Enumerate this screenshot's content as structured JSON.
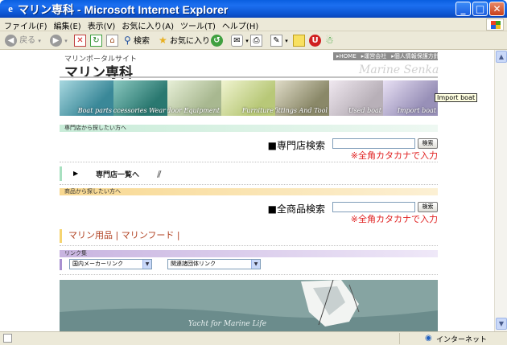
{
  "window": {
    "title": "マリン専科 - Microsoft Internet Explorer",
    "buttons": {
      "minimize": "_",
      "maximize": "□",
      "close": "✕"
    }
  },
  "menubar": {
    "items": [
      "ファイル(F)",
      "編集(E)",
      "表示(V)",
      "お気に入り(A)",
      "ツール(T)",
      "ヘルプ(H)"
    ]
  },
  "toolbar": {
    "back_label": "戻る",
    "search_label": "検索",
    "favorites_label": "お気に入り"
  },
  "page": {
    "portal_name": "マリンポータルサイト",
    "site_title": "マリン専科",
    "site_title_en": "Marine Senka",
    "topnav": [
      "▸HOME",
      "▸運営会社",
      "▸個人情報保護方針"
    ],
    "banners": [
      {
        "label": "Boat parts",
        "color_a": "#3a8898",
        "color_b": "#a8d8e0"
      },
      {
        "label": "Accessories Wear",
        "color_a": "#2a7870",
        "color_b": "#8ac8c0"
      },
      {
        "label": "The indoor Equipment",
        "color_a": "#a8b890",
        "color_b": "#e8f0d8"
      },
      {
        "label": "Furniture",
        "color_a": "#b8c878",
        "color_b": "#f0f4d0"
      },
      {
        "label": "Metal fittings And Tool",
        "color_a": "#8a8868",
        "color_b": "#e0dcc8"
      },
      {
        "label": "Used boat",
        "color_a": "#b8b0b8",
        "color_b": "#f0e8f0"
      },
      {
        "label": "Import boat",
        "color_a": "#9890b8",
        "color_b": "#e8e0f4"
      }
    ],
    "tooltip": "Import boat",
    "shop_section_title": "専門店から探したい方へ",
    "shop_search_label": "■専門店検索",
    "search_button": "検索",
    "katakana_note": "※全角カタカナで入力",
    "shop_list_label": "専門店一覧へ",
    "product_section_title": "商品から探したい方へ",
    "product_search_label": "■全商品検索",
    "category_links": "マリン用品 | マリンフード |",
    "links_section_title": "リンク集",
    "select1": "国内メーカーリンク",
    "select2": "関連諸団体リンク",
    "hero_caption": "Yacht for Marine Life"
  },
  "statusbar": {
    "zone_label": "インターネット"
  }
}
